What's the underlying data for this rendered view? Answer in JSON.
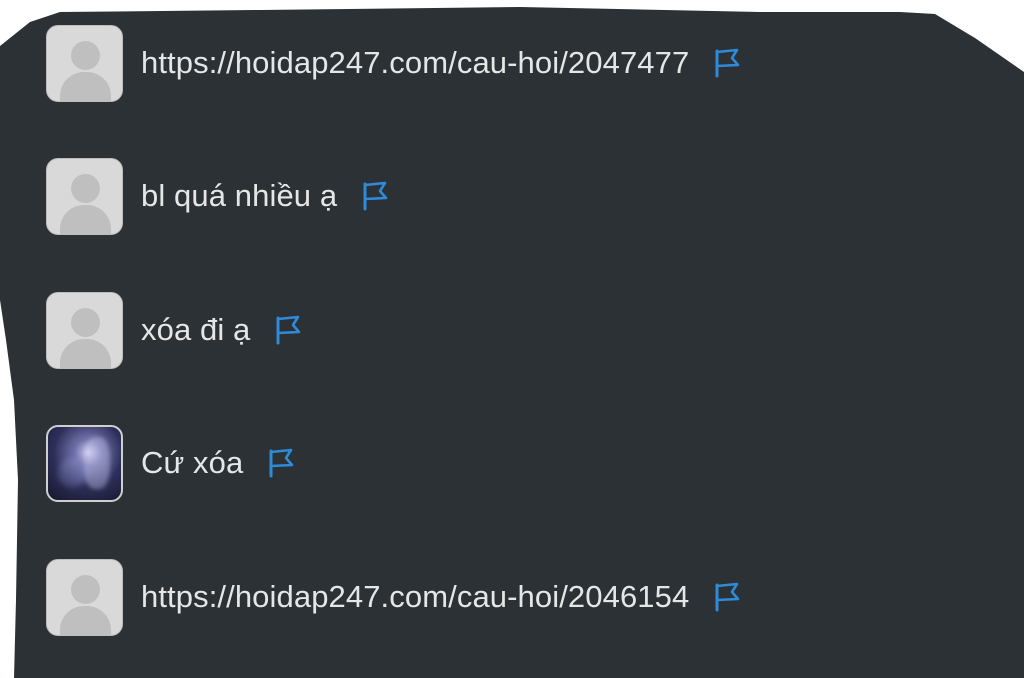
{
  "comments": [
    {
      "text": "https://hoidap247.com/cau-hoi/2047477",
      "avatar": "default-avatar",
      "flag_icon": "report-flag-icon"
    },
    {
      "text": "bl quá nhiều ạ",
      "avatar": "default-avatar",
      "flag_icon": "report-flag-icon"
    },
    {
      "text": "xóa đi ạ",
      "avatar": "default-avatar",
      "flag_icon": "report-flag-icon"
    },
    {
      "text": "Cứ xóa",
      "avatar": "photo-avatar",
      "flag_icon": "report-flag-icon"
    },
    {
      "text": "https://hoidap247.com/cau-hoi/2046154",
      "avatar": "default-avatar",
      "flag_icon": "report-flag-icon"
    }
  ],
  "colors": {
    "background": "#2b3134",
    "text": "#e6e6e6",
    "flag": "#2f8ad8",
    "avatar_placeholder": "#d9d9d9"
  }
}
